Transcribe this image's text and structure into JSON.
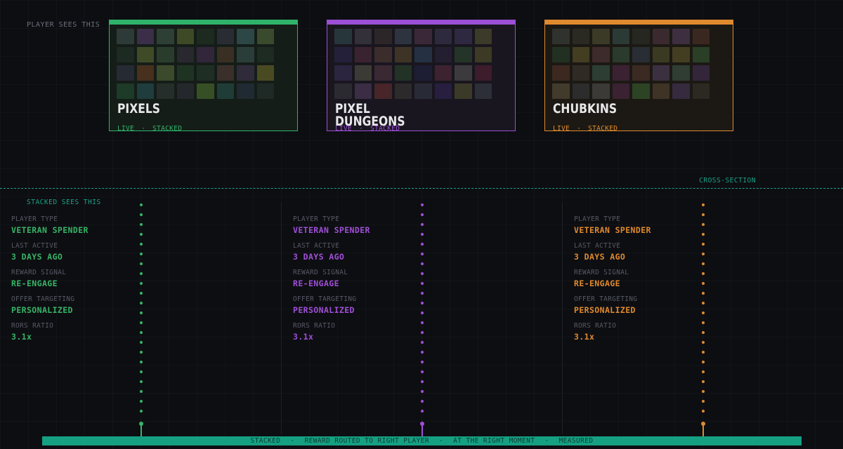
{
  "top_label": "PLAYER SEES THIS",
  "cards": [
    {
      "title": "PIXELS",
      "meta_live": "LIVE",
      "meta_sep": "·",
      "meta_stacked": "STACKED",
      "accent": "#2fb36a",
      "bg": "#151d18",
      "tiles": [
        "#2d3a37",
        "#3b2e48",
        "#2e3f35",
        "#3d4a25",
        "#1d2a20",
        "#2a2c33",
        "#2c4745",
        "#3a4a2c",
        "#1c2a22",
        "#3f4a27",
        "#2a3d2c",
        "#28282e",
        "#32263a",
        "#3a2f23",
        "#2b3d39",
        "#1d2b22",
        "#262a33",
        "#48301e",
        "#3a4a2a",
        "#1f3323",
        "#1f2e24",
        "#3b2f2b",
        "#302b3a",
        "#4a4a22",
        "#1e3a28",
        "#1f3d3c",
        "#262e2c",
        "#24282d",
        "#374f25",
        "#1f3d36",
        "#1f2a33",
        "#1f2a26"
      ]
    },
    {
      "title": "PIXEL DUNGEONS",
      "meta_live": "LIVE",
      "meta_sep": "·",
      "meta_stacked": "STACKED",
      "accent": "#9b4fd6",
      "bg": "#19161f",
      "tiles": [
        "#27363a",
        "#34303a",
        "#2c2628",
        "#2d3440",
        "#3a2838",
        "#2e2a3e",
        "#2e2940",
        "#3c3a28",
        "#25203a",
        "#3a2330",
        "#3a2d2c",
        "#3d3426",
        "#253042",
        "#241f30",
        "#243428",
        "#3c3a24",
        "#2b2540",
        "#3c3a34",
        "#3a2832",
        "#223326",
        "#1d1d33",
        "#3d2230",
        "#3c3a3c",
        "#3d1c2c",
        "#2b2a30",
        "#3a2d44",
        "#472529",
        "#2d2a2b",
        "#282a36",
        "#271e40",
        "#3b3a28",
        "#2c2f38"
      ]
    },
    {
      "title": "CHUBKINS",
      "meta_live": "LIVE",
      "meta_sep": "·",
      "meta_stacked": "STACKED",
      "accent": "#e08a2e",
      "bg": "#1c1914",
      "tiles": [
        "#30322d",
        "#2a2a22",
        "#3a3a26",
        "#2b3a34",
        "#272721",
        "#3a2a30",
        "#3d2f40",
        "#3a2820",
        "#223022",
        "#433d22",
        "#3d2a2a",
        "#2a3a2d",
        "#282e33",
        "#3a3a22",
        "#433d22",
        "#2a3f26",
        "#3d2820",
        "#2f2a24",
        "#2c3d33",
        "#3a2232",
        "#3a2a22",
        "#3b3040",
        "#2f3d33",
        "#33253a",
        "#423a2b",
        "#2c2c2c",
        "#3c3a36",
        "#3a2232",
        "#2d4424",
        "#3f3326",
        "#352a3e",
        "#2c2822"
      ]
    }
  ],
  "cross_section_label": "CROSS-SECTION",
  "stacked_label": "STACKED SEES THIS",
  "columns": [
    {
      "accent": "#37b466",
      "fields": [
        {
          "label": "PLAYER TYPE",
          "value": "VETERAN SPENDER"
        },
        {
          "label": "LAST ACTIVE",
          "value": "3 DAYS AGO"
        },
        {
          "label": "REWARD SIGNAL",
          "value": "RE-ENGAGE"
        },
        {
          "label": "OFFER TARGETING",
          "value": "PERSONALIZED"
        },
        {
          "label": "RORS RATIO",
          "value": "3.1x"
        }
      ]
    },
    {
      "accent": "#a04fd8",
      "fields": [
        {
          "label": "PLAYER TYPE",
          "value": "VETERAN SPENDER"
        },
        {
          "label": "LAST ACTIVE",
          "value": "3 DAYS AGO"
        },
        {
          "label": "REWARD SIGNAL",
          "value": "RE-ENGAGE"
        },
        {
          "label": "OFFER TARGETING",
          "value": "PERSONALIZED"
        },
        {
          "label": "RORS RATIO",
          "value": "3.1x"
        }
      ]
    },
    {
      "accent": "#e08a2e",
      "fields": [
        {
          "label": "PLAYER TYPE",
          "value": "VETERAN SPENDER"
        },
        {
          "label": "LAST ACTIVE",
          "value": "3 DAYS AGO"
        },
        {
          "label": "REWARD SIGNAL",
          "value": "RE-ENGAGE"
        },
        {
          "label": "OFFER TARGETING",
          "value": "PERSONALIZED"
        },
        {
          "label": "RORS RATIO",
          "value": "3.1x"
        }
      ]
    }
  ],
  "footer": {
    "items": [
      "STACKED",
      "REWARD ROUTED TO RIGHT PLAYER",
      "AT THE RIGHT MOMENT",
      "MEASURED"
    ],
    "separator": "·",
    "bg": "#15a082"
  }
}
